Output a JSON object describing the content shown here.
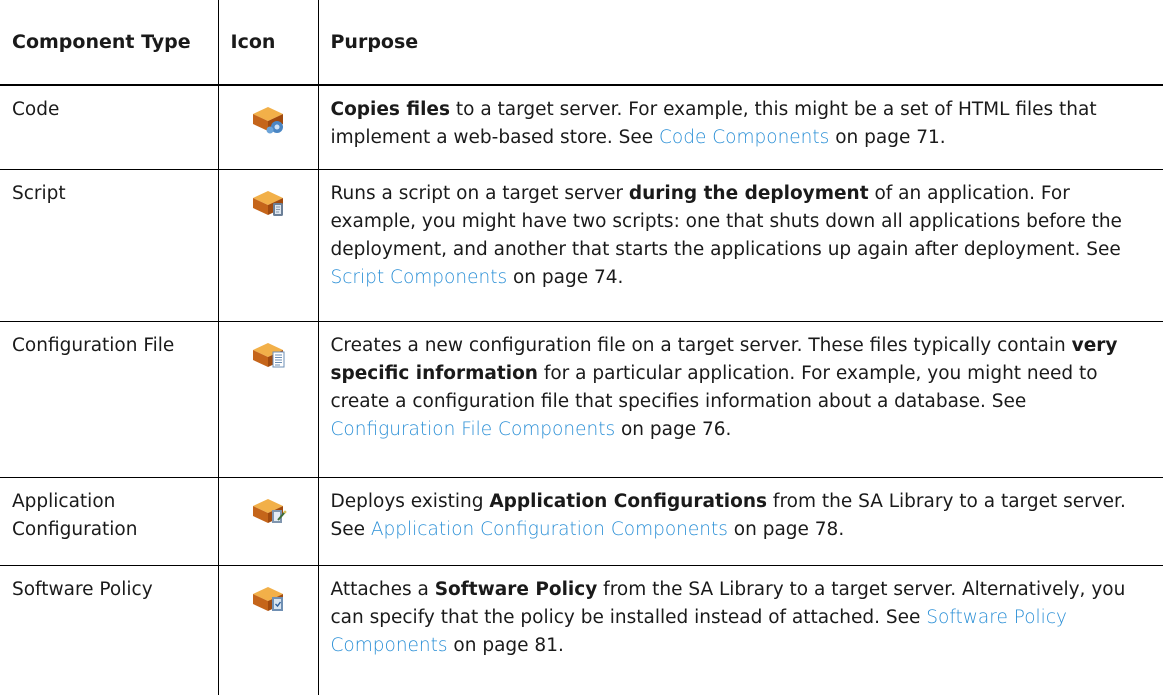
{
  "header": {
    "type_label": "Component Type",
    "icon_label": "Icon",
    "purpose_label": "Purpose"
  },
  "rows": [
    {
      "type": "Code",
      "icon": "code-component-icon",
      "purpose": {
        "bold": "Copies files",
        "text1": " to a target server. For example, this might be a set of HTML files that implement a web-based store. See ",
        "link": "Code Components",
        "page": " on page 71."
      }
    },
    {
      "type": "Script",
      "icon": "script-component-icon",
      "purpose": {
        "pre": "Runs a script on a target server ",
        "bold": "during the deployment",
        "text1": " of an application. For example, you might have two scripts: one that shuts down all applications before the deployment, and another that starts the applications up again after deployment. See ",
        "link": "Script Components",
        "page": " on page 74."
      }
    },
    {
      "type": "Configuration File",
      "icon": "configuration-file-component-icon",
      "purpose": {
        "pre": "Creates a new configuration file on a target server. These files typically contain ",
        "bold": "very specific information",
        "text1": " for a particular application. For example, you might need to create a configuration file that specifies information about a database. See ",
        "link": "Configuration File Components",
        "page": " on page 76."
      }
    },
    {
      "type": "Application Configuration",
      "icon": "application-configuration-component-icon",
      "purpose": {
        "pre": "Deploys existing ",
        "bold": "Application Configurations",
        "text1": " from the SA Library to a target server. See ",
        "link": "Application Configuration Components",
        "page": " on page 78."
      }
    },
    {
      "type": "Software Policy",
      "icon": "software-policy-component-icon",
      "purpose": {
        "pre": "Attaches a ",
        "bold": "Software Policy",
        "text1": " from the SA Library to a target server. Alternatively, you can specify that the policy be installed instead of attached. See ",
        "link": "Software Policy Components",
        "page": " on page 81."
      }
    }
  ]
}
